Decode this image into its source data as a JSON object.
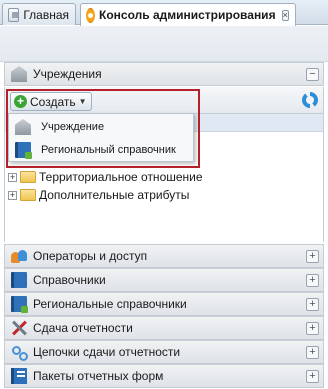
{
  "tabs": [
    {
      "label": "Главная",
      "icon": "home-icon",
      "active": false
    },
    {
      "label": "Консоль администрирования",
      "icon": "gear-icon",
      "active": true,
      "closable": true
    }
  ],
  "panels": {
    "institutions": {
      "label": "Учреждения",
      "icon": "institution-icon",
      "toggle": "−"
    },
    "operators": {
      "label": "Операторы и доступ",
      "icon": "users-icon",
      "toggle": "+"
    },
    "dictionaries": {
      "label": "Справочники",
      "icon": "book-icon",
      "toggle": "+"
    },
    "regional_dictionaries": {
      "label": "Региональные справочники",
      "icon": "regional-book-icon",
      "toggle": "+"
    },
    "reporting": {
      "label": "Сдача отчетности",
      "icon": "tools-icon",
      "toggle": "+"
    },
    "chains": {
      "label": "Цепочки сдачи отчетности",
      "icon": "chain-icon",
      "toggle": "+"
    },
    "packages": {
      "label": "Пакеты отчетных форм",
      "icon": "package-icon",
      "toggle": "+"
    }
  },
  "toolbar": {
    "create_label": "Создать",
    "create_icon": "plus-icon",
    "refresh_icon": "refresh-icon"
  },
  "create_menu": [
    {
      "label": "Учреждение",
      "icon": "institution-icon"
    },
    {
      "label": "Региональный справочник",
      "icon": "regional-book-icon"
    }
  ],
  "tree": [
    {
      "label": "Территориальное отношение",
      "expander": "+"
    },
    {
      "label": "Дополнительные атрибуты",
      "expander": "+"
    }
  ],
  "colors": {
    "highlight": "#b5202b",
    "accent": "#2d6fb8",
    "create_icon": "#3aa335"
  }
}
